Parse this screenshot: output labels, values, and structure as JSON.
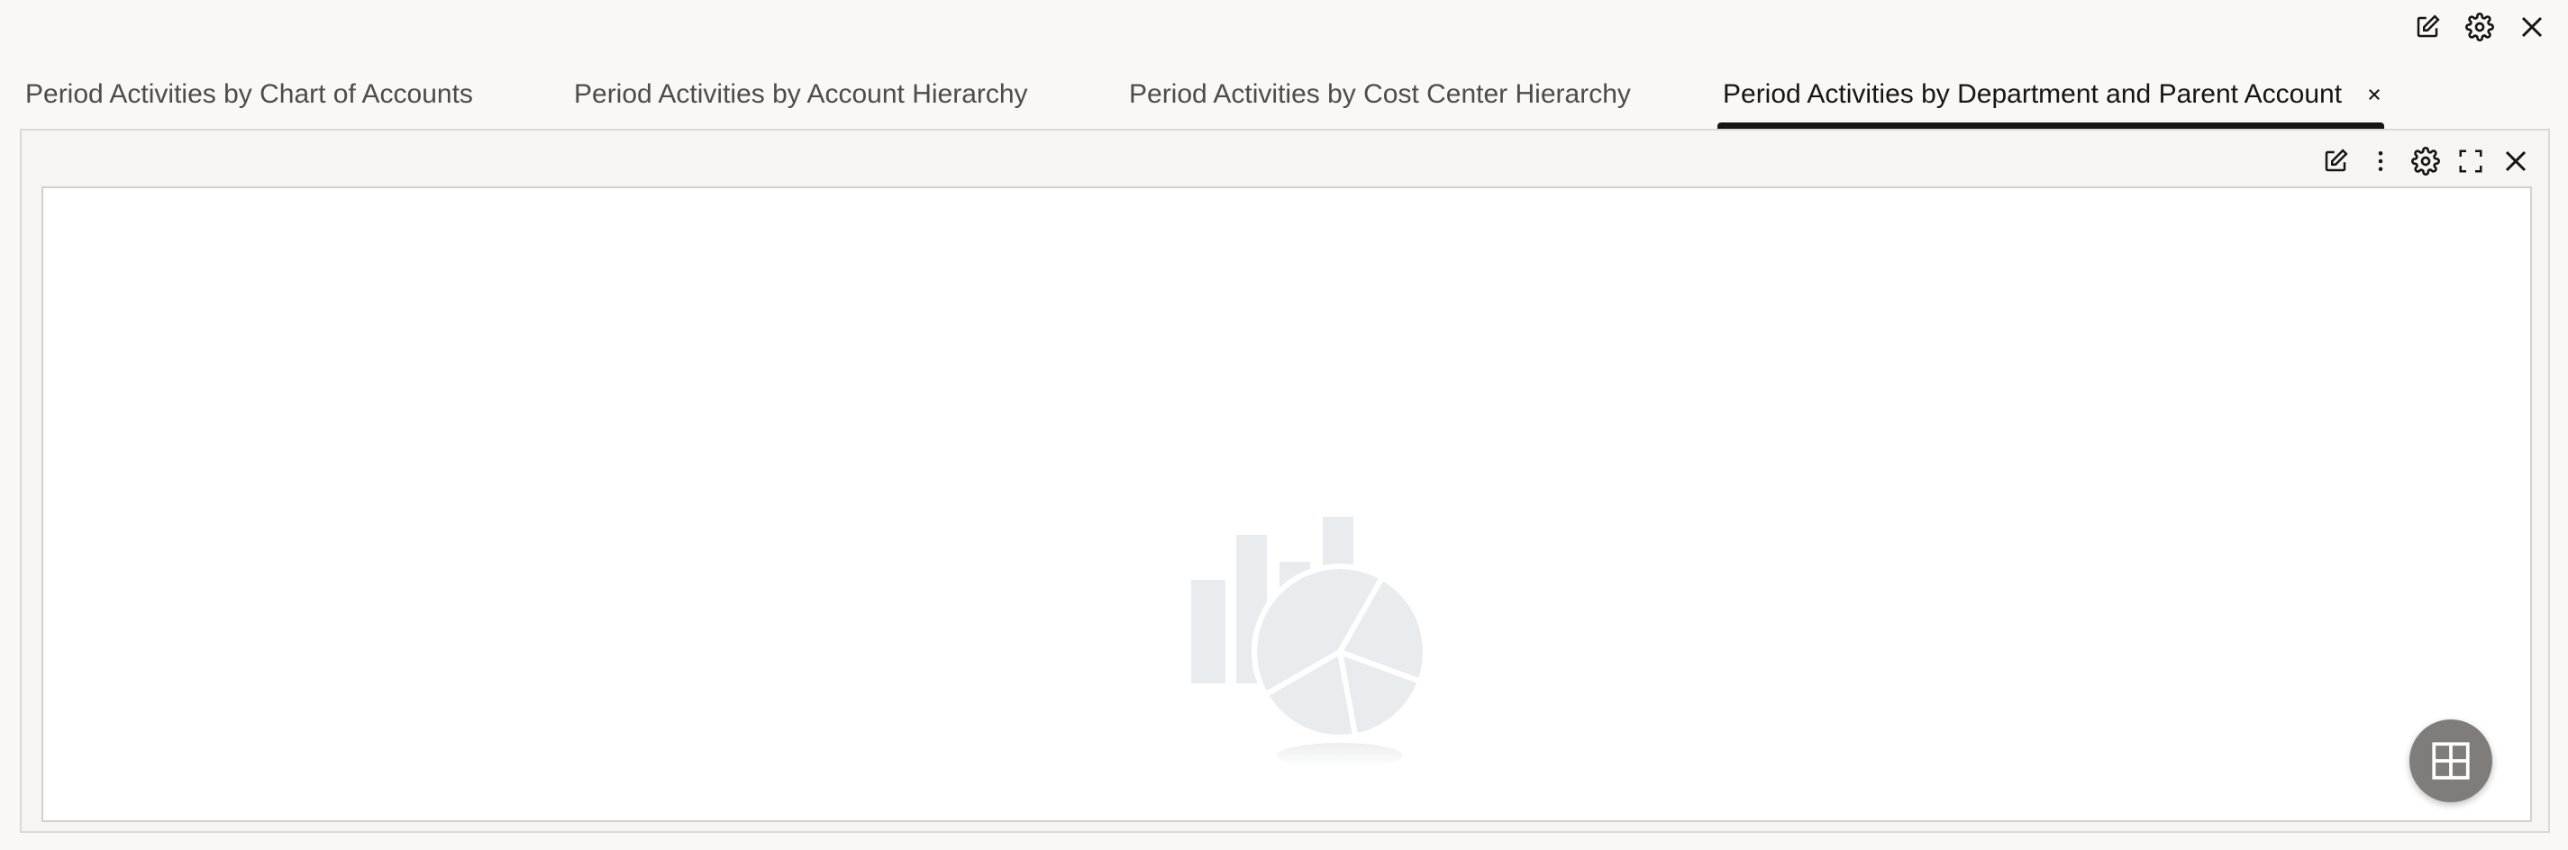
{
  "header": {
    "actions": [
      {
        "icon": "edit-icon"
      },
      {
        "icon": "gear-icon"
      },
      {
        "icon": "close-icon"
      }
    ]
  },
  "tabs": [
    {
      "label": "Period Activities by Chart of Accounts",
      "active": false
    },
    {
      "label": "Period Activities by Account Hierarchy",
      "active": false
    },
    {
      "label": "Period Activities by Cost Center Hierarchy",
      "active": false
    },
    {
      "label": "Period Activities by Department and Parent Account",
      "active": true,
      "closable": true
    }
  ],
  "panel": {
    "toolbar": [
      {
        "icon": "edit-icon"
      },
      {
        "icon": "more-vertical-icon"
      },
      {
        "icon": "gear-icon"
      },
      {
        "icon": "fullscreen-icon"
      },
      {
        "icon": "close-icon"
      }
    ],
    "placeholder_icon": "chart-placeholder-icon"
  },
  "fab": {
    "icon": "grid-view-icon"
  },
  "colors": {
    "page_background": "#f9f8f6",
    "active_tab_text": "#161513",
    "inactive_tab_text": "#4f4b47",
    "active_tab_indicator": "#161513",
    "placeholder_art": "#e9ecef",
    "fab_background": "#7f7c79"
  }
}
